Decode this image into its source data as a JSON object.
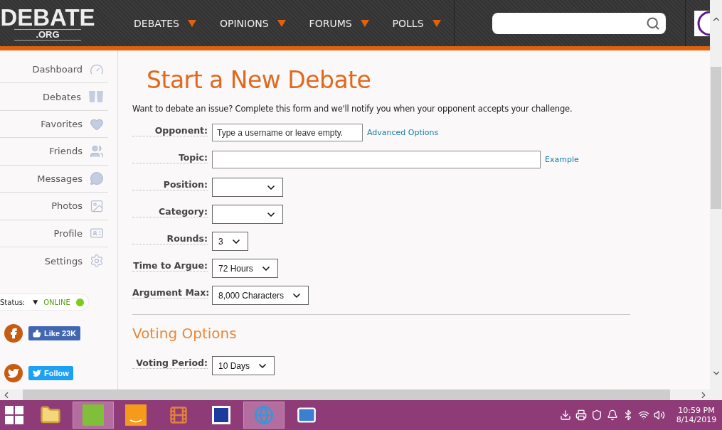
{
  "header": {
    "logo": {
      "name": "DEBATE",
      "suffix": ".ORG"
    },
    "nav": [
      {
        "label": "DEBATES"
      },
      {
        "label": "OPINIONS"
      },
      {
        "label": "FORUMS"
      },
      {
        "label": "POLLS"
      }
    ]
  },
  "sidebar": {
    "items": [
      {
        "label": "Dashboard",
        "kind": "dashboard"
      },
      {
        "label": "Debates",
        "kind": "debates"
      },
      {
        "label": "Favorites",
        "kind": "favorites"
      },
      {
        "label": "Friends",
        "kind": "friends"
      },
      {
        "label": "Messages",
        "kind": "messages"
      },
      {
        "label": "Photos",
        "kind": "photos"
      },
      {
        "label": "Profile",
        "kind": "profile"
      },
      {
        "label": "Settings",
        "kind": "settings"
      }
    ],
    "status": {
      "label": "Status:",
      "caret": "▼",
      "value": "ONLINE",
      "online": true
    },
    "social": [
      {
        "kind": "facebook",
        "label": "Like 23K"
      },
      {
        "kind": "twitter",
        "label": "Follow"
      }
    ]
  },
  "main": {
    "title": "Start a New Debate",
    "intro": "Want to debate an issue? Complete this form and we'll notify you when your opponent accepts your challenge.",
    "fields": [
      {
        "label": "Opponent:",
        "kind": "input",
        "placeholder": "Type a username or leave empty.",
        "link": "Advanced Options"
      },
      {
        "label": "Topic:",
        "kind": "input",
        "link": "Example"
      },
      {
        "label": "Position:",
        "kind": "select"
      },
      {
        "label": "Category:",
        "kind": "select"
      },
      {
        "label": "Rounds:",
        "kind": "select",
        "value": "3"
      },
      {
        "label": "Time to Argue:",
        "kind": "select",
        "value": "72 Hours"
      },
      {
        "label": "Argument Max:",
        "kind": "select",
        "value": "8,000 Characters"
      }
    ],
    "voting": {
      "heading": "Voting Options",
      "fields": [
        {
          "label": "Voting Period:",
          "kind": "select",
          "value": "10 Days"
        }
      ]
    }
  },
  "taskbar": {
    "apps": [
      {
        "kind": "folder",
        "selected": false
      },
      {
        "kind": "green",
        "selected": true
      },
      {
        "kind": "amazon",
        "selected": false
      },
      {
        "kind": "media",
        "selected": false
      },
      {
        "kind": "word",
        "selected": false
      },
      {
        "kind": "browser",
        "selected": true
      },
      {
        "kind": "mail",
        "selected": false
      }
    ],
    "clock": {
      "time": "10:59 PM",
      "date": "8/14/2019"
    }
  }
}
